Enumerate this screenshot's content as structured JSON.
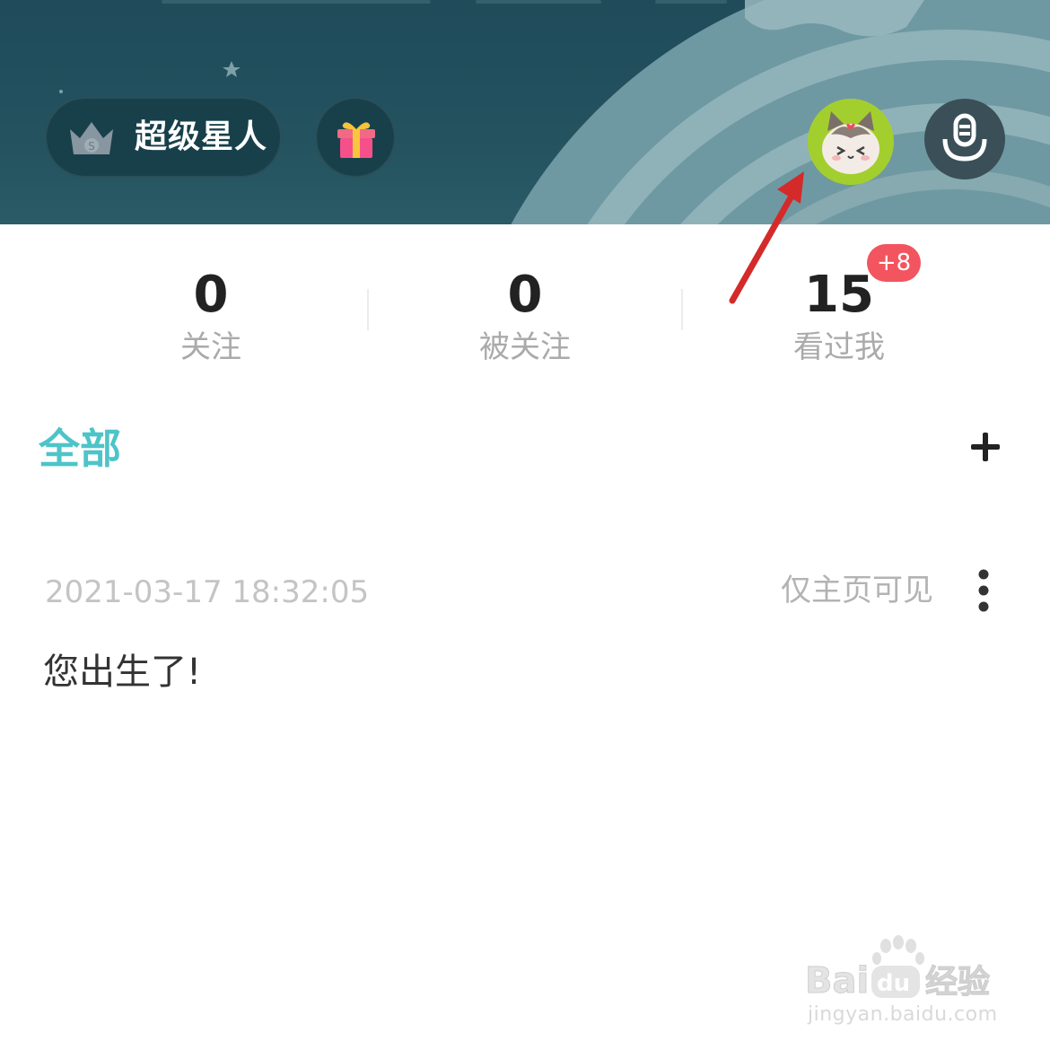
{
  "header": {
    "vip_label": "超级星人",
    "icons": [
      "crown-icon",
      "gift-icon",
      "cat-avatar",
      "mic-icon"
    ],
    "colors": {
      "banner": "#1f4b5a",
      "avatar_bg": "#a3cf2e"
    }
  },
  "stats": [
    {
      "value": "0",
      "label": "关注"
    },
    {
      "value": "0",
      "label": "被关注"
    },
    {
      "value": "15",
      "label": "看过我",
      "badge": "+8"
    }
  ],
  "filter": {
    "tab_label": "全部",
    "add_icon": "plus-icon"
  },
  "post": {
    "timestamp": "2021-03-17 18:32:05",
    "visibility": "仅主页可见",
    "content": "您出生了!",
    "menu_icon": "more-vertical-icon"
  },
  "watermark": {
    "logo_text": "Baidu经验",
    "url": "jingyan.baidu.com"
  },
  "annotation": {
    "arrow_color": "#d42a2a"
  },
  "accent": "#4dc4c8"
}
